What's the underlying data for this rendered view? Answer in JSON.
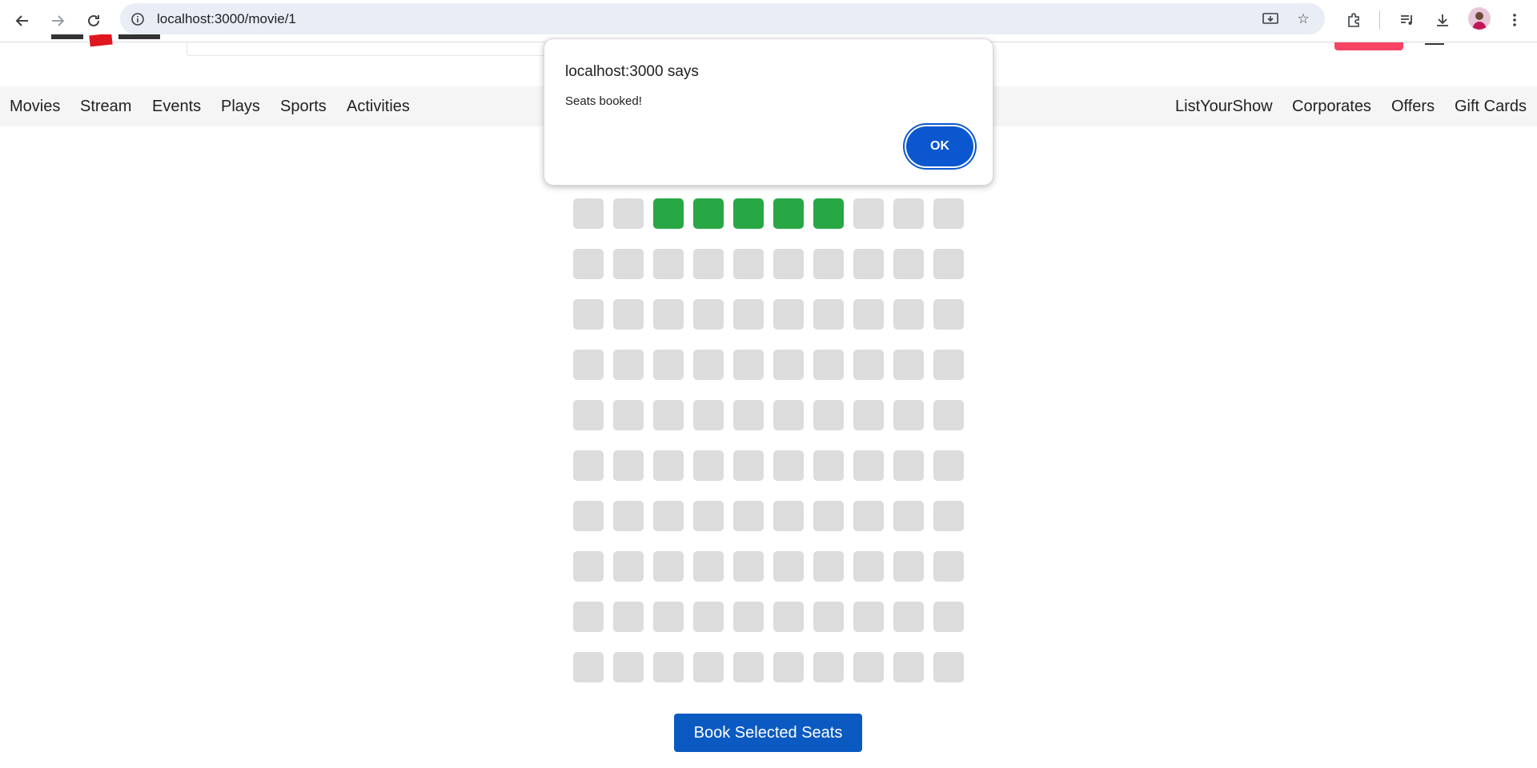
{
  "browser": {
    "url": "localhost:3000/movie/1"
  },
  "nav": {
    "left_items": [
      "Movies",
      "Stream",
      "Events",
      "Plays",
      "Sports",
      "Activities"
    ],
    "right_items": [
      "ListYourShow",
      "Corporates",
      "Offers",
      "Gift Cards"
    ]
  },
  "seats": {
    "rows": 10,
    "columns": 10,
    "selected": [
      [
        0,
        2
      ],
      [
        0,
        3
      ],
      [
        0,
        4
      ],
      [
        0,
        5
      ],
      [
        0,
        6
      ]
    ],
    "colors": {
      "available": "#dcdcdc",
      "selected": "#28a745"
    }
  },
  "book_button_label": "Book Selected Seats",
  "dialog": {
    "title": "localhost:3000 says",
    "message": "Seats booked!",
    "ok_label": "OK"
  },
  "colors": {
    "primary": "#0b5ac1",
    "accent": "#f84464"
  }
}
